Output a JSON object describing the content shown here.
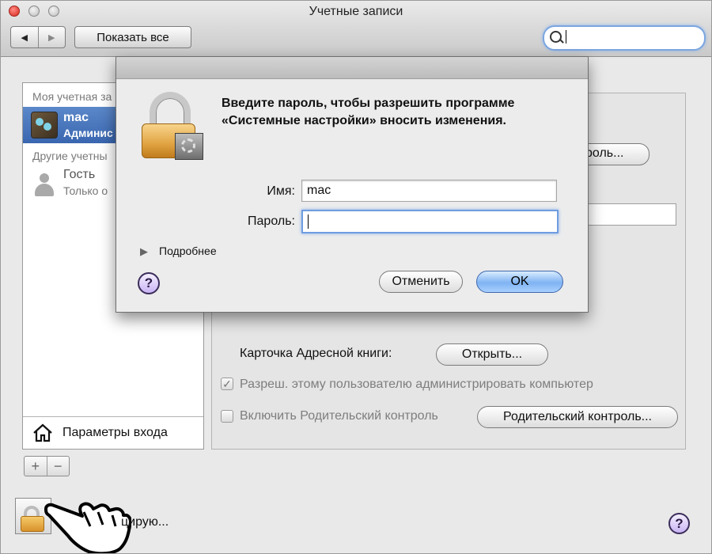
{
  "window": {
    "title": "Учетные записи"
  },
  "toolbar": {
    "back_glyph": "◀",
    "forward_glyph": "▶",
    "show_all": "Показать все"
  },
  "sidebar": {
    "my_account_header": "Моя учетная за",
    "user": {
      "name": "mac",
      "role": "Админис"
    },
    "other_header": "Другие учетны",
    "guest": {
      "name": "Гость",
      "sub": "Только о"
    },
    "login_options": "Параметры входа",
    "add_glyph": "+",
    "remove_glyph": "−"
  },
  "main": {
    "password_button_partial": "роль...",
    "address_card_label": "Карточка Адресной книги:",
    "open_button": "Открыть...",
    "admin_checkbox": {
      "checked": true,
      "label": "Разреш. этому пользователю администрировать компьютер"
    },
    "parental_checkbox": {
      "checked": false,
      "label": "Включить Родительский контроль"
    },
    "parental_button": "Родительский контроль..."
  },
  "bottom": {
    "lock_text": "цирую...",
    "help": "?"
  },
  "dialog": {
    "prompt": "Введите пароль, чтобы разрешить программе «Системные настройки» вносить изменения.",
    "name_label": "Имя:",
    "name_value": "mac",
    "password_label": "Пароль:",
    "password_value": "",
    "details": "Подробнее",
    "disclosure_glyph": "▶",
    "help": "?",
    "cancel": "Отменить",
    "ok": "OK"
  },
  "colors": {
    "selection": "#3a66b0",
    "ok_button": "#7fb3f2",
    "lock": "#e0a341"
  },
  "icons": [
    "search-icon",
    "lock-icon",
    "home-icon",
    "guest-icon",
    "pointing-hand-cursor-icon",
    "help-icon"
  ]
}
